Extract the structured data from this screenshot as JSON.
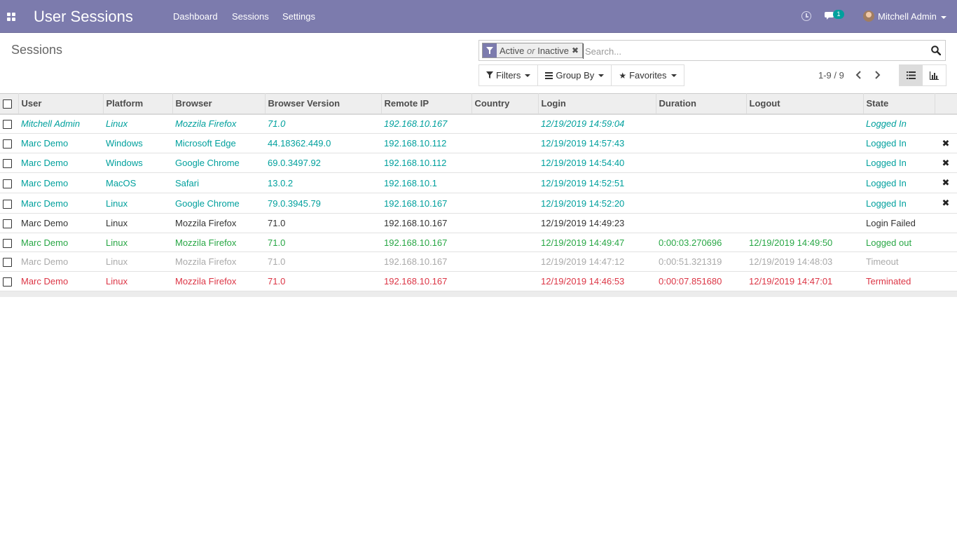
{
  "navbar": {
    "app_title": "User Sessions",
    "menus": [
      "Dashboard",
      "Sessions",
      "Settings"
    ],
    "chat_count": "1",
    "user_name": "Mitchell Admin",
    "bg_color": "#7c7bad"
  },
  "control": {
    "breadcrumb": "Sessions",
    "facet": {
      "values": [
        "Active",
        "Inactive"
      ],
      "separator": "or"
    },
    "search_placeholder": "Search...",
    "filters_label": "Filters",
    "groupby_label": "Group By",
    "favorites_label": "Favorites",
    "pager": "1-9 / 9"
  },
  "table": {
    "columns": [
      "User",
      "Platform",
      "Browser",
      "Browser Version",
      "Remote IP",
      "Country",
      "Login",
      "Duration",
      "Logout",
      "State"
    ],
    "rows": [
      {
        "user": "Mitchell Admin",
        "platform": "Linux",
        "browser": "Mozzila Firefox",
        "version": "71.0",
        "ip": "192.168.10.167",
        "country": "",
        "login": "12/19/2019 14:59:04",
        "duration": "",
        "logout": "",
        "state": "Logged In",
        "color": "#00a09d",
        "italic": true,
        "close": false
      },
      {
        "user": "Marc Demo",
        "platform": "Windows",
        "browser": "Microsoft Edge",
        "version": "44.18362.449.0",
        "ip": "192.168.10.112",
        "country": "",
        "login": "12/19/2019 14:57:43",
        "duration": "",
        "logout": "",
        "state": "Logged In",
        "color": "#00a09d",
        "italic": false,
        "close": true
      },
      {
        "user": "Marc Demo",
        "platform": "Windows",
        "browser": "Google Chrome",
        "version": "69.0.3497.92",
        "ip": "192.168.10.112",
        "country": "",
        "login": "12/19/2019 14:54:40",
        "duration": "",
        "logout": "",
        "state": "Logged In",
        "color": "#00a09d",
        "italic": false,
        "close": true
      },
      {
        "user": "Marc Demo",
        "platform": "MacOS",
        "browser": "Safari",
        "version": "13.0.2",
        "ip": "192.168.10.1",
        "country": "",
        "login": "12/19/2019 14:52:51",
        "duration": "",
        "logout": "",
        "state": "Logged In",
        "color": "#00a09d",
        "italic": false,
        "close": true
      },
      {
        "user": "Marc Demo",
        "platform": "Linux",
        "browser": "Google Chrome",
        "version": "79.0.3945.79",
        "ip": "192.168.10.167",
        "country": "",
        "login": "12/19/2019 14:52:20",
        "duration": "",
        "logout": "",
        "state": "Logged In",
        "color": "#00a09d",
        "italic": false,
        "close": true
      },
      {
        "user": "Marc Demo",
        "platform": "Linux",
        "browser": "Mozzila Firefox",
        "version": "71.0",
        "ip": "192.168.10.167",
        "country": "",
        "login": "12/19/2019 14:49:23",
        "duration": "",
        "logout": "",
        "state": "Login Failed",
        "color": "#333333",
        "italic": false,
        "close": false
      },
      {
        "user": "Marc Demo",
        "platform": "Linux",
        "browser": "Mozzila Firefox",
        "version": "71.0",
        "ip": "192.168.10.167",
        "country": "",
        "login": "12/19/2019 14:49:47",
        "duration": "0:00:03.270696",
        "logout": "12/19/2019 14:49:50",
        "state": "Logged out",
        "color": "#28a745",
        "italic": false,
        "close": false
      },
      {
        "user": "Marc Demo",
        "platform": "Linux",
        "browser": "Mozzila Firefox",
        "version": "71.0",
        "ip": "192.168.10.167",
        "country": "",
        "login": "12/19/2019 14:47:12",
        "duration": "0:00:51.321319",
        "logout": "12/19/2019 14:48:03",
        "state": "Timeout",
        "color": "#aaaaaa",
        "italic": false,
        "close": false
      },
      {
        "user": "Marc Demo",
        "platform": "Linux",
        "browser": "Mozzila Firefox",
        "version": "71.0",
        "ip": "192.168.10.167",
        "country": "",
        "login": "12/19/2019 14:46:53",
        "duration": "0:00:07.851680",
        "logout": "12/19/2019 14:47:01",
        "state": "Terminated",
        "color": "#dc3545",
        "italic": false,
        "close": false
      }
    ]
  },
  "icons": {
    "apps": "apps-icon",
    "clock": "clock-icon",
    "chat": "chat-icon",
    "filter": "filter-icon",
    "search": "search-icon",
    "list_view": "list-view-icon",
    "graph_view": "graph-view-icon",
    "close": "close-icon"
  }
}
